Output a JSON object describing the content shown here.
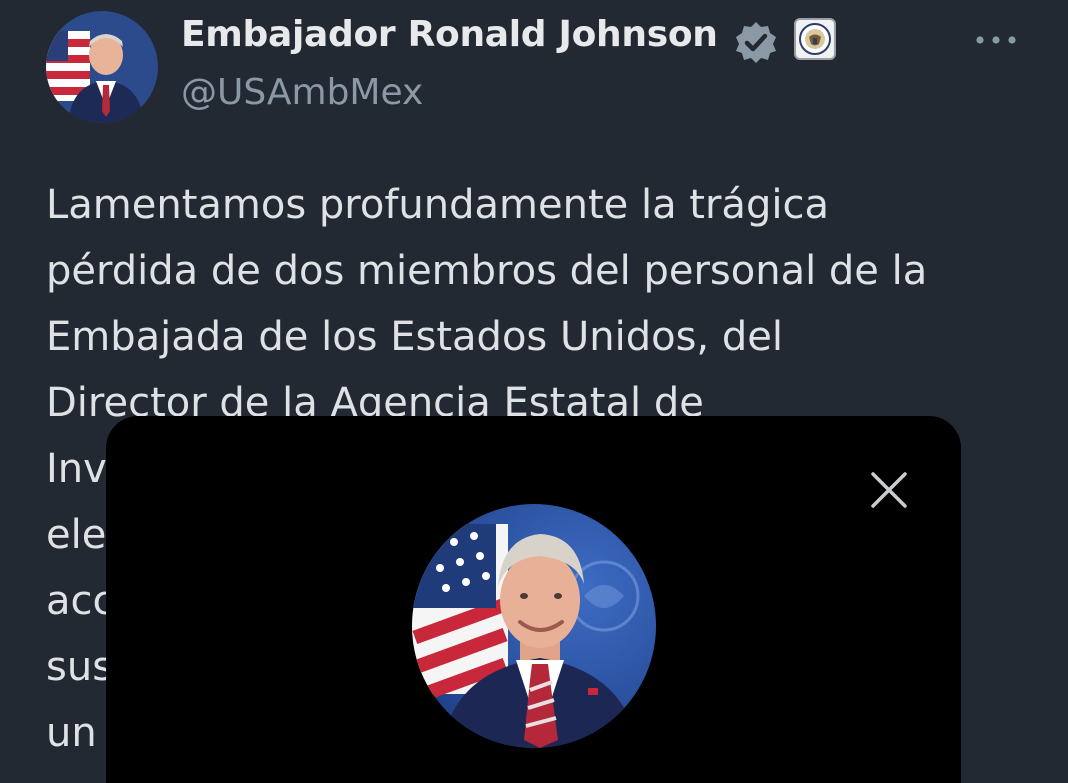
{
  "tweet": {
    "author": {
      "display_name": "Embajador Ronald Johnson",
      "handle": "@USAmbMex",
      "verified_icon": "verified-badge-icon",
      "affiliate_icon": "state-department-seal-icon"
    },
    "more_icon": "more-options-icon",
    "text_lines": [
      "Lamentamos profundamente la trágica",
      "pérdida de dos miembros del personal de la",
      "Embajada de los Estados Unidos, del",
      "Director de la Agencia Estatal de",
      "Inv",
      "ele",
      "acc",
      "sus",
      "un"
    ]
  },
  "overlay": {
    "close_icon": "close-icon",
    "avatar": "profile-photo"
  },
  "colors": {
    "background": "#232932",
    "overlay": "#000000",
    "name": "#e7e9ea",
    "handle": "#8b98a5",
    "verified": "#8b98a5"
  }
}
